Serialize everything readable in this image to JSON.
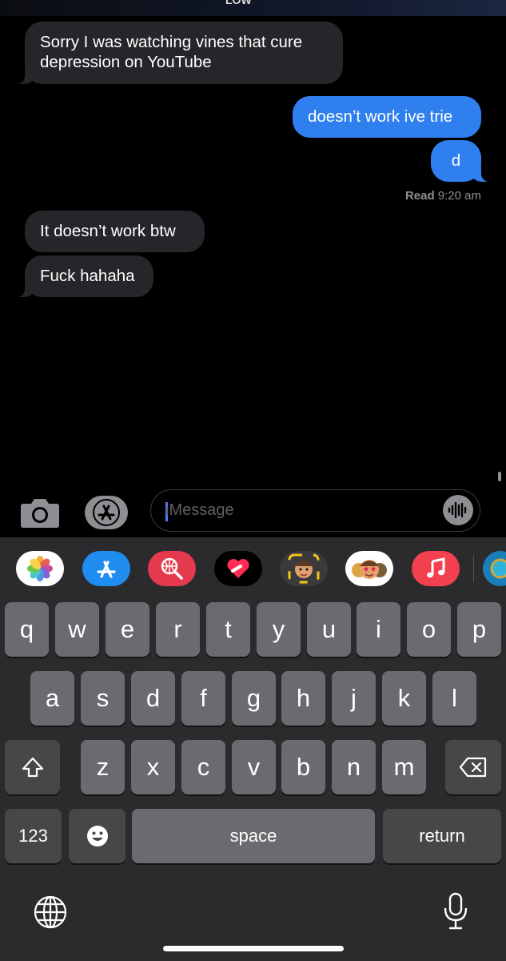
{
  "status_bar": {
    "fragment": "LOW"
  },
  "messages": [
    {
      "id": "m1",
      "direction": "incoming",
      "lines": [
        "Sorry I was watching vines that cure",
        "depression on YouTube"
      ]
    },
    {
      "id": "m2",
      "direction": "outgoing",
      "text": "doesn’t work ive trie"
    },
    {
      "id": "m3",
      "direction": "outgoing",
      "text": "d"
    },
    {
      "id": "m4",
      "direction": "incoming",
      "text": "It doesn’t work btw"
    },
    {
      "id": "m5",
      "direction": "incoming",
      "text": "Fuck hahaha"
    }
  ],
  "read_receipt": {
    "label": "Read",
    "time": "9:20 am"
  },
  "compose": {
    "placeholder": "iMessage"
  },
  "app_strip": [
    "photos",
    "app-store",
    "web-search",
    "digital-touch",
    "memoji-stickers",
    "animoji",
    "music",
    "more-app"
  ],
  "keyboard": {
    "row1": [
      "q",
      "w",
      "e",
      "r",
      "t",
      "y",
      "u",
      "i",
      "o",
      "p"
    ],
    "row2": [
      "a",
      "s",
      "d",
      "f",
      "g",
      "h",
      "j",
      "k",
      "l"
    ],
    "row3": [
      "z",
      "x",
      "c",
      "v",
      "b",
      "n",
      "m"
    ],
    "numbers_label": "123",
    "space_label": "space",
    "return_label": "return"
  },
  "colors": {
    "outgoing_bubble": "#2f80ee",
    "incoming_bubble": "#26252a",
    "keyboard_bg": "#2b2b2d",
    "key": "#6b6b6f"
  }
}
